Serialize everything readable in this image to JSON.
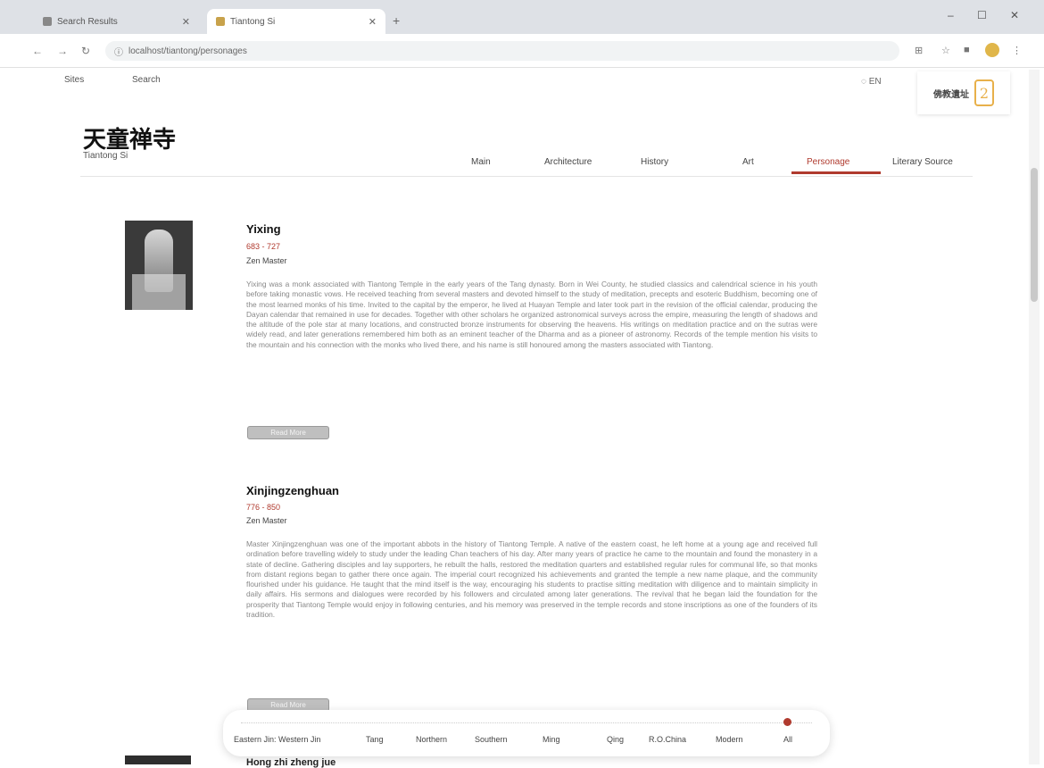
{
  "browser": {
    "tabs": [
      {
        "label": "Search Results",
        "active": false
      },
      {
        "label": "Tiantong Si",
        "active": true
      }
    ],
    "address": "localhost/tiantong/personages",
    "window_controls": [
      "–",
      "☐",
      "✕"
    ]
  },
  "header": {
    "topnav": [
      "Sites",
      "Search"
    ],
    "language": "EN",
    "brand_text": "佛教遺址"
  },
  "site": {
    "title": "天童禅寺",
    "subtitle": "Tiantong Si"
  },
  "page_nav": {
    "items": [
      "Main",
      "Architecture",
      "History",
      "Art",
      "Personage",
      "Literary Source"
    ],
    "active": "Personage"
  },
  "entries": [
    {
      "name": "Yixing",
      "years": "683 - 727",
      "role": "Zen Master",
      "bio": "Yixing was a monk associated with Tiantong Temple in the early years of the Tang dynasty. Born in Wei County, he studied classics and calendrical science in his youth before taking monastic vows. He received teaching from several masters and devoted himself to the study of meditation, precepts and esoteric Buddhism, becoming one of the most learned monks of his time. Invited to the capital by the emperor, he lived at Huayan Temple and later took part in the revision of the official calendar, producing the Dayan calendar that remained in use for decades. Together with other scholars he organized astronomical surveys across the empire, measuring the length of shadows and the altitude of the pole star at many locations, and constructed bronze instruments for observing the heavens. His writings on meditation practice and on the sutras were widely read, and later generations remembered him both as an eminent teacher of the Dharma and as a pioneer of astronomy. Records of the temple mention his visits to the mountain and his connection with the monks who lived there, and his name is still honoured among the masters associated with Tiantong.",
      "more": "Read More"
    },
    {
      "name": "Xinjingzenghuan",
      "years": "776 - 850",
      "role": "Zen Master",
      "bio": "Master Xinjingzenghuan was one of the important abbots in the history of Tiantong Temple. A native of the eastern coast, he left home at a young age and received full ordination before travelling widely to study under the leading Chan teachers of his day. After many years of practice he came to the mountain and found the monastery in a state of decline. Gathering disciples and lay supporters, he rebuilt the halls, restored the meditation quarters and established regular rules for communal life, so that monks from distant regions began to gather there once again. The imperial court recognized his achievements and granted the temple a new name plaque, and the community flourished under his guidance. He taught that the mind itself is the way, encouraging his students to practise sitting meditation with diligence and to maintain simplicity in daily affairs. His sermons and dialogues were recorded by his followers and circulated among later generations. The revival that he began laid the foundation for the prosperity that Tiantong Temple would enjoy in following centuries, and his memory was preserved in the temple records and stone inscriptions as one of the founders of its tradition.",
      "more": "Read More"
    }
  ],
  "next_entry": {
    "name": "Hong zhi zheng jue"
  },
  "timeline": {
    "items": [
      "Eastern Jin: Western Jin",
      "Tang",
      "Northern",
      "Southern",
      "Ming",
      "Qing",
      "R.O.China",
      "Modern",
      "All"
    ],
    "selected": "All"
  },
  "colors": {
    "accent": "#b03a2e",
    "brand": "#e8b04a"
  }
}
